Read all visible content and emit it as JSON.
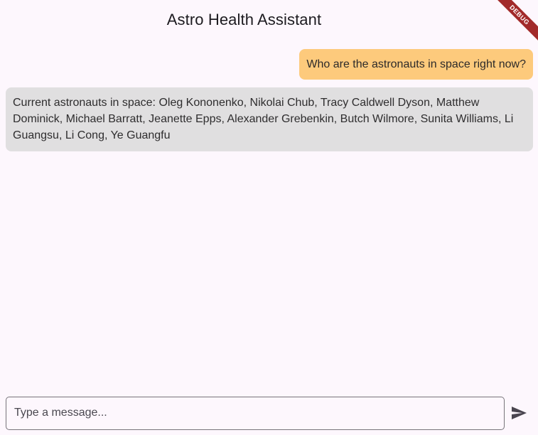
{
  "app_bar": {
    "title": "Astro Health Assistant"
  },
  "debug_banner": {
    "label": "DEBUG",
    "color": "#a22a2a"
  },
  "messages": [
    {
      "role": "user",
      "text": "Who are the astronauts in space right now?",
      "color": "#fdca7c"
    },
    {
      "role": "assistant",
      "text": "Current astronauts in space: Oleg Kononenko, Nikolai Chub, Tracy Caldwell Dyson, Matthew Dominick, Michael Barratt, Jeanette Epps, Alexander Grebenkin, Butch Wilmore, Sunita Williams, Li Guangsu, Li Cong, Ye Guangfu",
      "color": "#e0dfe0"
    }
  ],
  "composer": {
    "placeholder": "Type a message...",
    "value": "",
    "send_icon": "send-icon"
  },
  "colors": {
    "background": "#fdf7fd",
    "user_bubble": "#fdca7c",
    "assistant_bubble": "#e0dfe0"
  }
}
